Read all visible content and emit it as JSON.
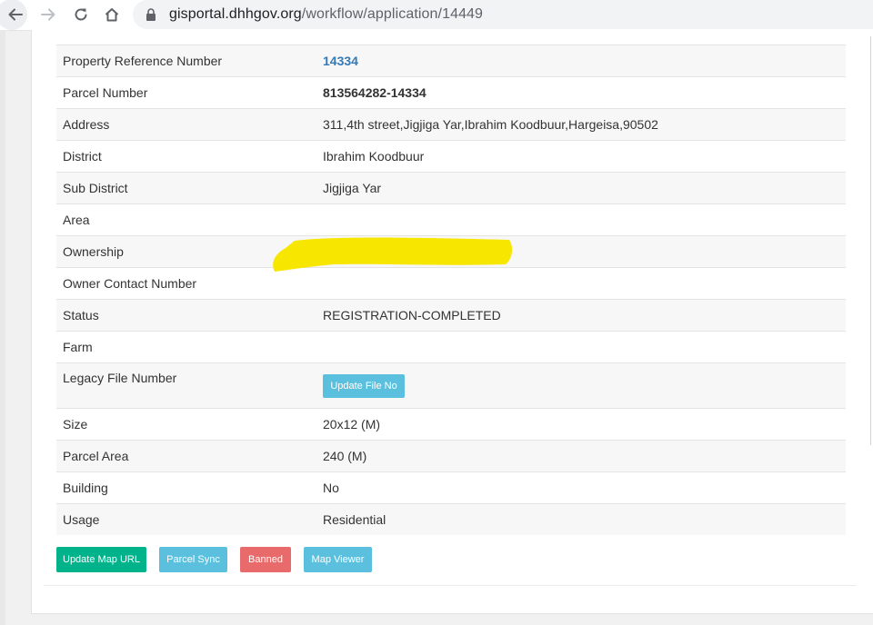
{
  "browser": {
    "url_host": "gisportal.dhhgov.org",
    "url_path": "/workflow/application/14449"
  },
  "details": {
    "rows": [
      {
        "label": "Property Reference Number",
        "value": "14334"
      },
      {
        "label": "Parcel Number",
        "value": "813564282-14334"
      },
      {
        "label": "Address",
        "value": "311,4th street,Jigjiga Yar,Ibrahim Koodbuur,Hargeisa,90502"
      },
      {
        "label": "District",
        "value": "Ibrahim Koodbuur"
      },
      {
        "label": "Sub District",
        "value": "Jigjiga Yar"
      },
      {
        "label": "Area",
        "value": ""
      },
      {
        "label": "Ownership",
        "value": ""
      },
      {
        "label": "Owner Contact Number",
        "value": ""
      },
      {
        "label": "Status",
        "value": "REGISTRATION-COMPLETED"
      },
      {
        "label": "Farm",
        "value": ""
      },
      {
        "label": "Legacy File Number",
        "button": "Update File No"
      },
      {
        "label": "Size",
        "value": "20x12 (M)"
      },
      {
        "label": "Parcel Area",
        "value": "240 (M)"
      },
      {
        "label": "Building",
        "value": "No"
      },
      {
        "label": "Usage",
        "value": "Residential"
      }
    ]
  },
  "actions": {
    "update_map_url": "Update Map URL",
    "parcel_sync": "Parcel Sync",
    "banned": "Banned",
    "map_viewer": "Map Viewer"
  },
  "colors": {
    "success": "#00b38a",
    "info": "#5bc0de",
    "danger": "#e96a6a",
    "link": "#337ab7",
    "highlight": "#f7e600"
  }
}
